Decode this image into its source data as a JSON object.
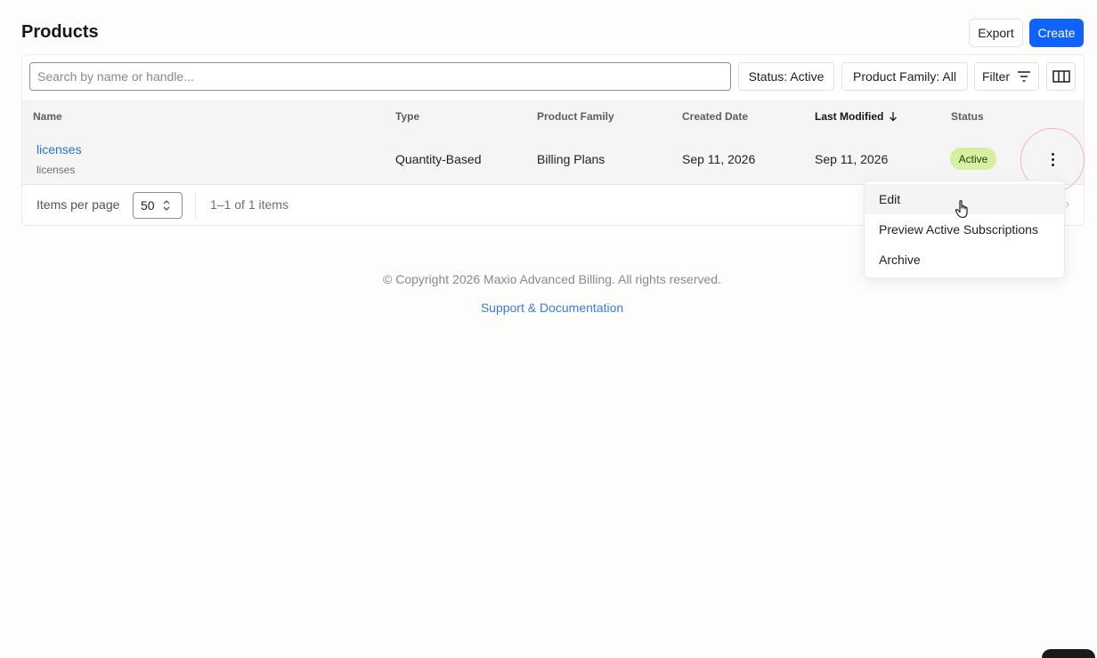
{
  "header": {
    "title": "Products",
    "export_label": "Export",
    "create_label": "Create"
  },
  "toolbar": {
    "search_placeholder": "Search by name or handle...",
    "status_filter": "Status: Active",
    "family_filter": "Product Family: All",
    "filter_label": "Filter",
    "columns_icon": "columns-icon"
  },
  "table": {
    "columns": [
      "Name",
      "Type",
      "Product Family",
      "Created Date",
      "Last Modified",
      "Status"
    ],
    "sorted_column": "Last Modified",
    "rows": [
      {
        "name": "licenses",
        "handle": "licenses",
        "type": "Quantity-Based",
        "family": "Billing Plans",
        "created": "Sep 11, 2026",
        "modified": "Sep 11, 2026",
        "status": "Active"
      }
    ]
  },
  "pagination": {
    "items_per_page_label": "Items per page",
    "items_per_page": "50",
    "count_text": "1–1 of 1 items"
  },
  "row_menu": {
    "items": [
      "Edit",
      "Preview Active Subscriptions",
      "Archive"
    ]
  },
  "footer": {
    "copyright": "© Copyright 2026 Maxio Advanced Billing. All rights reserved.",
    "link": "Support & Documentation"
  },
  "colors": {
    "primary": "#0f62fe",
    "link": "#2f6fd8",
    "active_badge_bg": "#d4f0a0"
  }
}
